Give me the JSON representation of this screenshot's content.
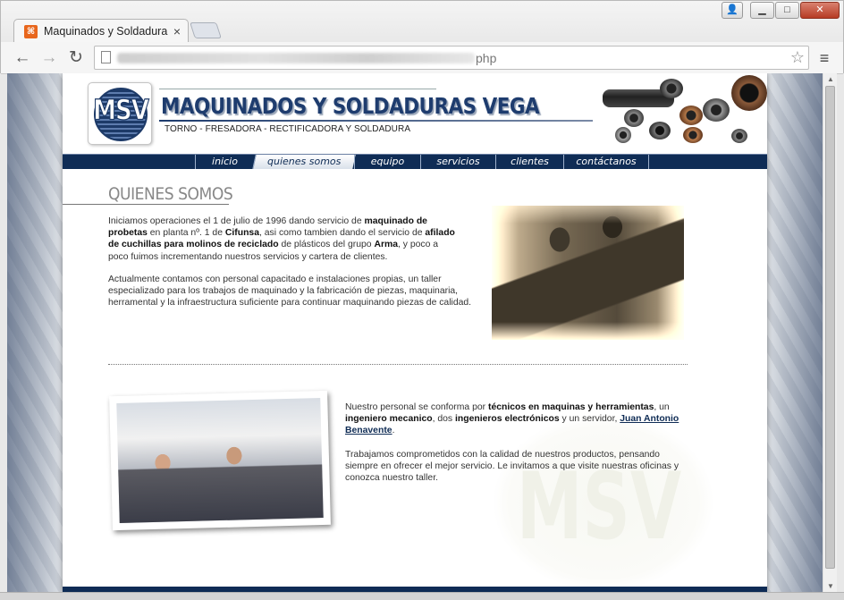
{
  "browser": {
    "tab_title": "Maquinados y Soldadura",
    "tab_close": "×",
    "url_suffix": "php",
    "window_buttons": {
      "minimize": "▁",
      "maximize": "□",
      "close": "✕"
    }
  },
  "header": {
    "logo_text": "MSV",
    "site_title": "MAQUINADOS Y SOLDADURAS VEGA",
    "tagline": "TORNO - FRESADORA - RECTIFICADORA Y SOLDADURA"
  },
  "nav": {
    "items": [
      {
        "label": "inicio"
      },
      {
        "label": "quienes somos",
        "active": true
      },
      {
        "label": "equipo"
      },
      {
        "label": "servicios"
      },
      {
        "label": "clientes"
      },
      {
        "label": "contáctanos"
      }
    ]
  },
  "content": {
    "section_title": "QUIENES SOMOS",
    "intro1": {
      "t1": "Iniciamos operaciones el 1 de julio de 1996 dando servicio de ",
      "b1": "maquinado de probetas",
      "t2": " en planta nº. 1 de ",
      "b2": "Cifunsa",
      "t3": ", asi como tambien dando el servicio de ",
      "b3": "afilado de cuchillas para molinos de reciclado",
      "t4": " de plásticos del grupo ",
      "b4": "Arma",
      "t5": ", y poco a poco fuimos incrementando nuestros servicios y cartera de clientes."
    },
    "intro2": "Actualmente contamos con personal capacitado e instalaciones propias, un taller especializado para los trabajos de maquinado y la fabricación de piezas, maquinaria, herramental y la infraestructura suficiente para continuar maquinando piezas de calidad.",
    "team1": {
      "t1": "Nuestro personal se conforma por ",
      "b1": "técnicos en maquinas y herramientas",
      "t2": ", un ",
      "b2": "ingeniero mecanico",
      "t3": ", dos ",
      "b3": "ingenieros electrónicos",
      "t4": " y un servidor, ",
      "link": "Juan Antonio Benavente",
      "t5": "."
    },
    "team2": "Trabajamos comprometidos con la calidad de nuestros productos, pensando siempre en ofrecer el mejor servicio. Le invitamos a que visite nuestras oficinas y conozca nuestro taller.",
    "watermark": "MSV"
  }
}
